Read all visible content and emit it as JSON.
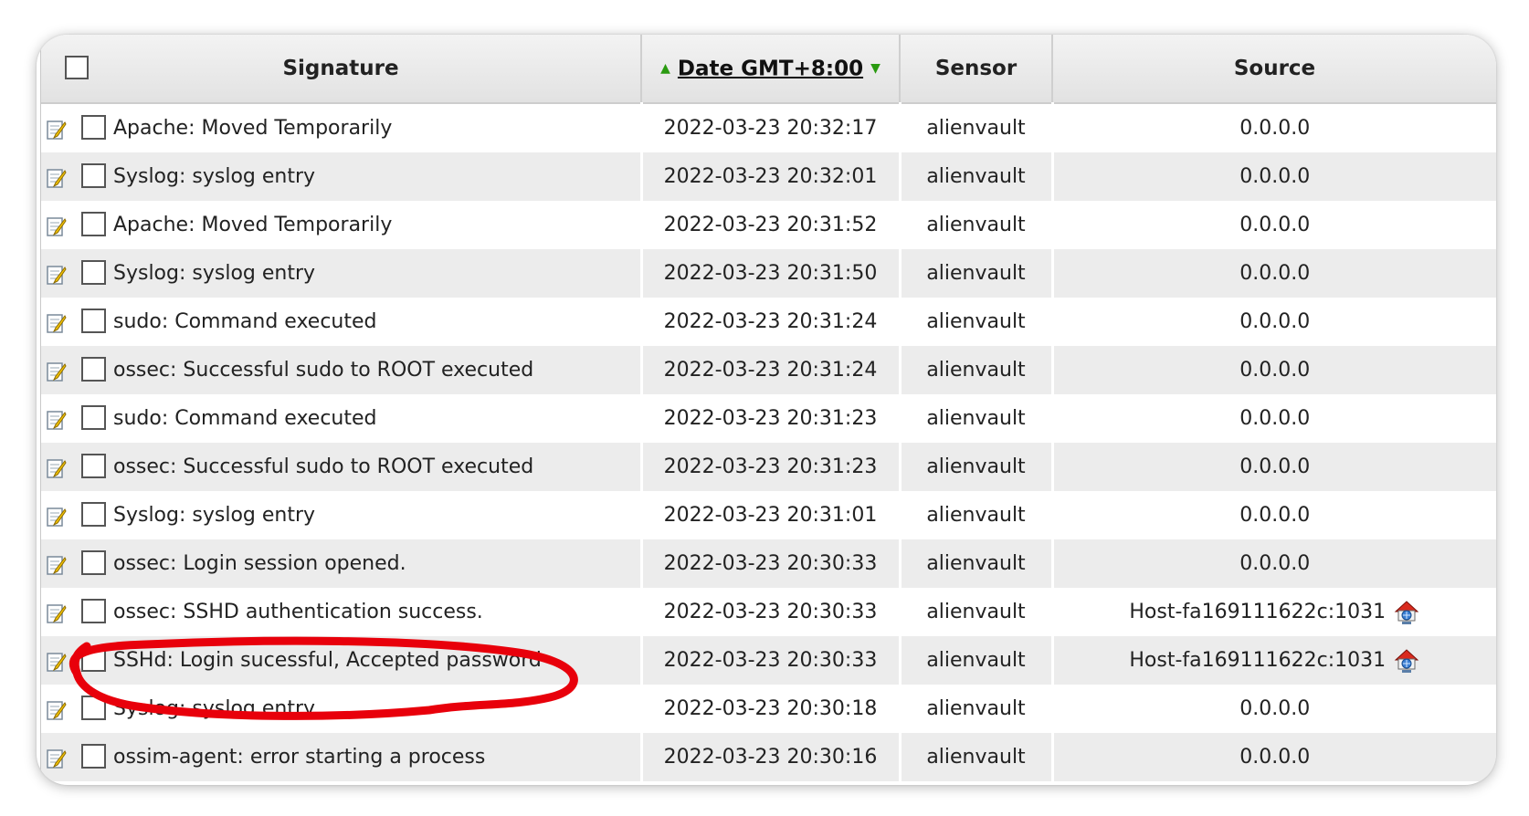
{
  "table": {
    "headers": {
      "signature": "Signature",
      "date": "Date GMT+8:00",
      "sensor": "Sensor",
      "source": "Source"
    },
    "rows": [
      {
        "signature": "Apache: Moved Temporarily",
        "date": "2022-03-23 20:32:17",
        "sensor": "alienvault",
        "source": "0.0.0.0"
      },
      {
        "signature": "Syslog: syslog entry",
        "date": "2022-03-23 20:32:01",
        "sensor": "alienvault",
        "source": "0.0.0.0"
      },
      {
        "signature": "Apache: Moved Temporarily",
        "date": "2022-03-23 20:31:52",
        "sensor": "alienvault",
        "source": "0.0.0.0"
      },
      {
        "signature": "Syslog: syslog entry",
        "date": "2022-03-23 20:31:50",
        "sensor": "alienvault",
        "source": "0.0.0.0"
      },
      {
        "signature": "sudo: Command executed",
        "date": "2022-03-23 20:31:24",
        "sensor": "alienvault",
        "source": "0.0.0.0"
      },
      {
        "signature": "ossec: Successful sudo to ROOT executed",
        "date": "2022-03-23 20:31:24",
        "sensor": "alienvault",
        "source": "0.0.0.0"
      },
      {
        "signature": "sudo: Command executed",
        "date": "2022-03-23 20:31:23",
        "sensor": "alienvault",
        "source": "0.0.0.0"
      },
      {
        "signature": "ossec: Successful sudo to ROOT executed",
        "date": "2022-03-23 20:31:23",
        "sensor": "alienvault",
        "source": "0.0.0.0"
      },
      {
        "signature": "Syslog: syslog entry",
        "date": "2022-03-23 20:31:01",
        "sensor": "alienvault",
        "source": "0.0.0.0"
      },
      {
        "signature": "ossec: Login session opened.",
        "date": "2022-03-23 20:30:33",
        "sensor": "alienvault",
        "source": "0.0.0.0"
      },
      {
        "signature": "ossec: SSHD authentication success.",
        "date": "2022-03-23 20:30:33",
        "sensor": "alienvault",
        "source": "Host-fa169111622c:1031",
        "host_icon": "host-network-icon"
      },
      {
        "signature": "SSHd: Login sucessful, Accepted password",
        "date": "2022-03-23 20:30:33",
        "sensor": "alienvault",
        "source": "Host-fa169111622c:1031",
        "host_icon": "host-network-icon"
      },
      {
        "signature": "Syslog: syslog entry",
        "date": "2022-03-23 20:30:18",
        "sensor": "alienvault",
        "source": "0.0.0.0"
      },
      {
        "signature": "ossim-agent: error starting a process",
        "date": "2022-03-23 20:30:16",
        "sensor": "alienvault",
        "source": "0.0.0.0"
      }
    ]
  },
  "colors": {
    "sort_arrow": "#2a9a10",
    "annotation": "#e8000b",
    "row_alt": "#ececec"
  },
  "icons": {
    "edit": "edit-note-icon",
    "host": "host-network-icon"
  }
}
